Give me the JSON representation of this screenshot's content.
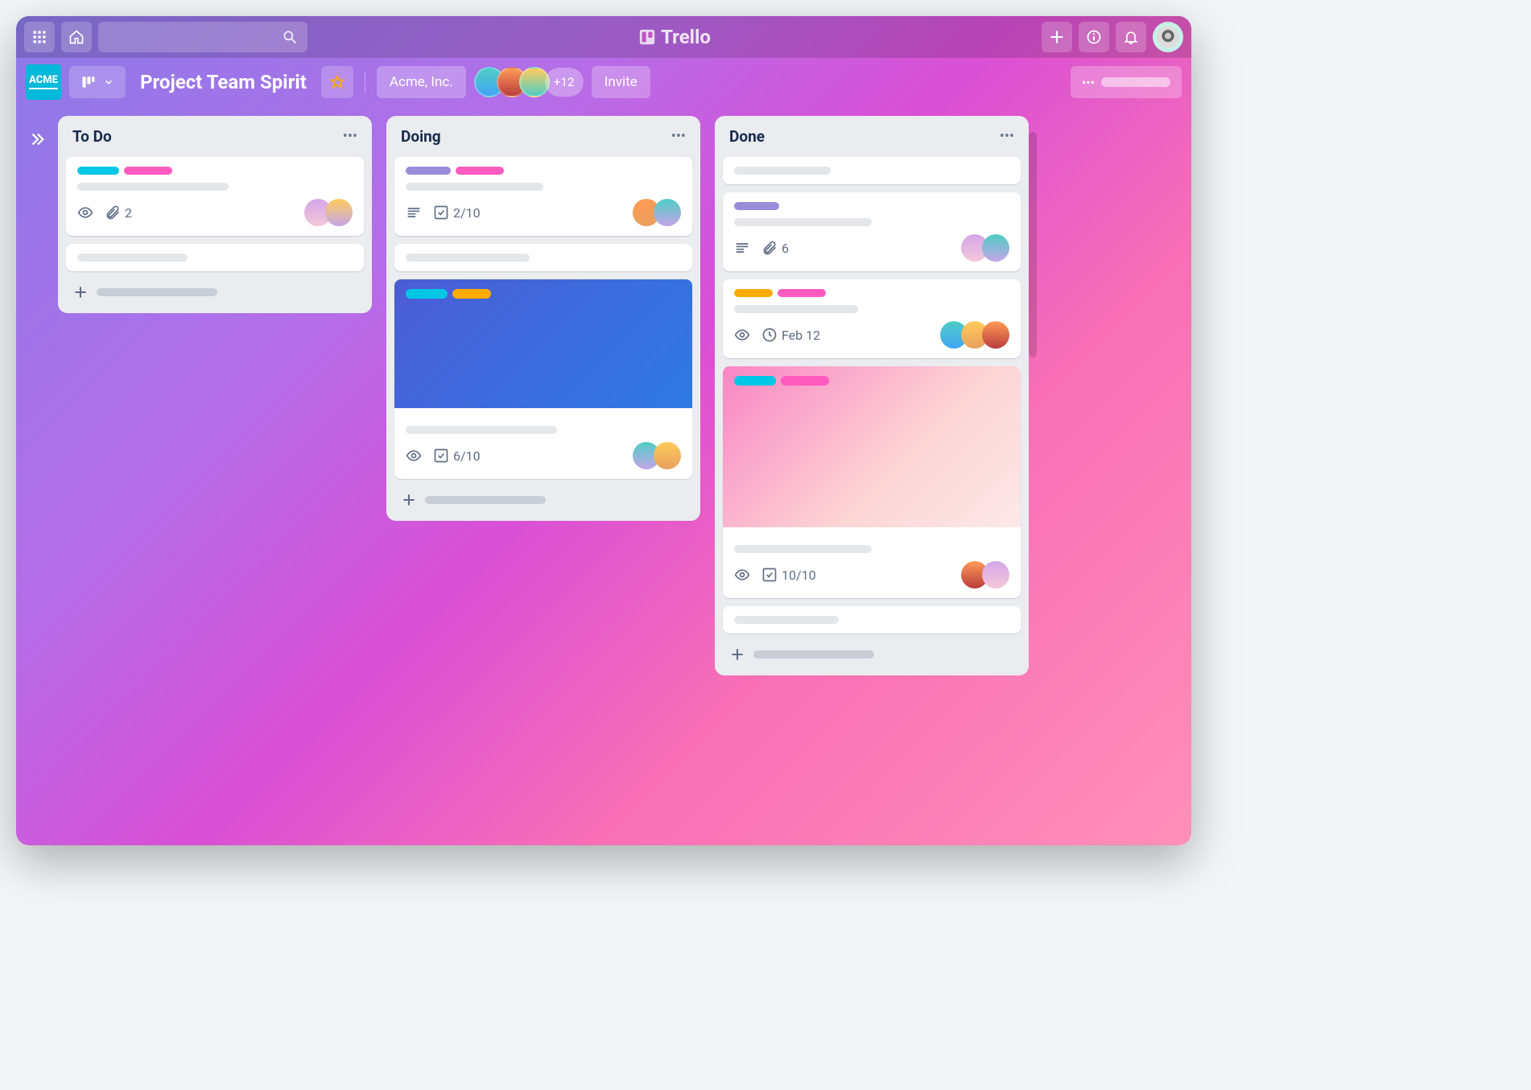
{
  "brand": "Trello",
  "workspace_logo": "ACME",
  "board": {
    "title": "Project Team Spirit",
    "org": "Acme, Inc.",
    "member_overflow": "+12",
    "invite": "Invite"
  },
  "lists": [
    {
      "title": "To Do",
      "cards": [
        {
          "labels": [
            "cyan",
            "pink"
          ],
          "badges": {
            "watching": true,
            "attachments": "2"
          },
          "members": 2
        },
        {
          "placeholder": true
        }
      ]
    },
    {
      "title": "Doing",
      "cards": [
        {
          "labels": [
            "purple",
            "pink"
          ],
          "badges": {
            "description": true,
            "checklist": "2/10"
          },
          "members": 2
        },
        {
          "placeholder": true
        },
        {
          "cover": "blue",
          "cover_labels": [
            "cyan",
            "yellow"
          ],
          "badges": {
            "watching": true,
            "checklist": "6/10"
          },
          "members": 2
        }
      ]
    },
    {
      "title": "Done",
      "cards": [
        {
          "placeholder": true
        },
        {
          "labels": [
            "purple"
          ],
          "badges": {
            "description": true,
            "attachments": "6"
          },
          "members": 2
        },
        {
          "labels": [
            "yellow",
            "pink"
          ],
          "badges": {
            "watching": true,
            "due": "Feb 12"
          },
          "members": 3
        },
        {
          "cover": "pink",
          "cover_labels": [
            "cyan",
            "pink"
          ],
          "badges": {
            "watching": true,
            "checklist": "10/10"
          },
          "members": 2
        },
        {
          "placeholder": true
        }
      ]
    }
  ]
}
